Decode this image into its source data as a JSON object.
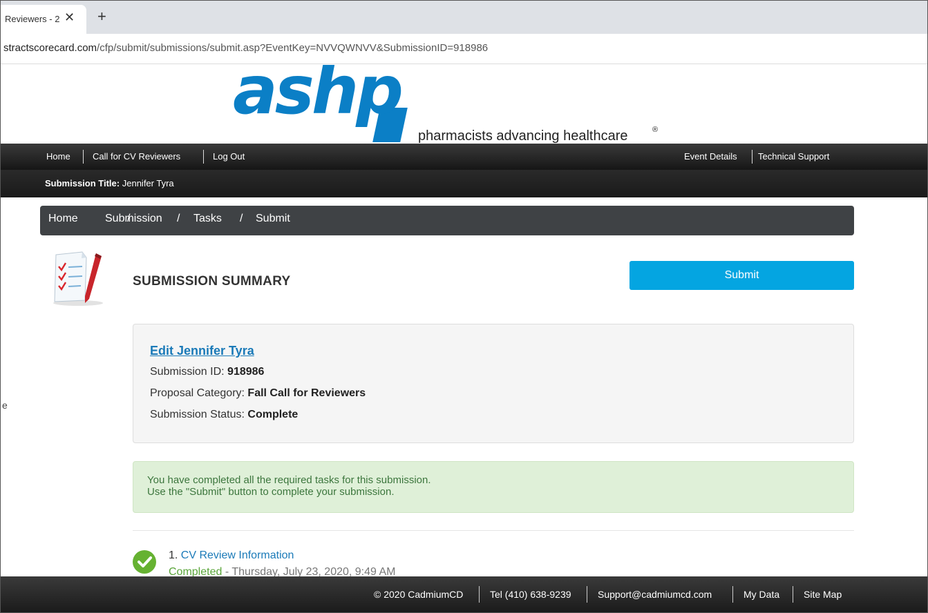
{
  "browser": {
    "tab_title": "Reviewers - 2",
    "close_label": "✕",
    "new_tab_label": "+",
    "url_host": "stractscorecard.com",
    "url_path": "/cfp/submit/submissions/submit.asp?EventKey=NVVQWNVV&SubmissionID=918986"
  },
  "logo": {
    "wordmark": "ashp",
    "tagline": "pharmacists advancing healthcare",
    "registered": "®",
    "brand_color": "#0b7fc6"
  },
  "topnav": {
    "left": [
      "Home",
      "Call for CV Reviewers",
      "Log Out"
    ],
    "right": [
      "Event Details",
      "Technical Support"
    ]
  },
  "titlebar": {
    "label": "Submission Title:",
    "value": "Jennifer Tyra"
  },
  "breadcrumb": [
    "Home",
    "/",
    "Submission",
    "/",
    "Tasks",
    "/",
    "Submit"
  ],
  "summary": {
    "heading": "SUBMISSION SUMMARY",
    "submit_label": "Submit",
    "accent_color": "#04a5e1"
  },
  "info": {
    "edit_link": "Edit Jennifer Tyra",
    "id_label": "Submission ID:",
    "id_value": "918986",
    "category_label": "Proposal Category:",
    "category_value": "Fall Call for Reviewers",
    "status_label": "Submission Status:",
    "status_value": "Complete"
  },
  "alert": {
    "line1": "You have completed all the required tasks for this submission.",
    "line2": "Use the \"Submit\" button to complete your submission."
  },
  "tasks": [
    {
      "number": "1.",
      "title": "CV Review Information",
      "status": "Completed",
      "timestamp": "- Thursday, July 23, 2020, 9:49 AM"
    }
  ],
  "footer": {
    "items": [
      "© 2020 CadmiumCD",
      "Tel (410) 638-9239",
      "Support@cadmiumcd.com",
      "My Data",
      "Site Map"
    ]
  },
  "edge_mark": "e"
}
